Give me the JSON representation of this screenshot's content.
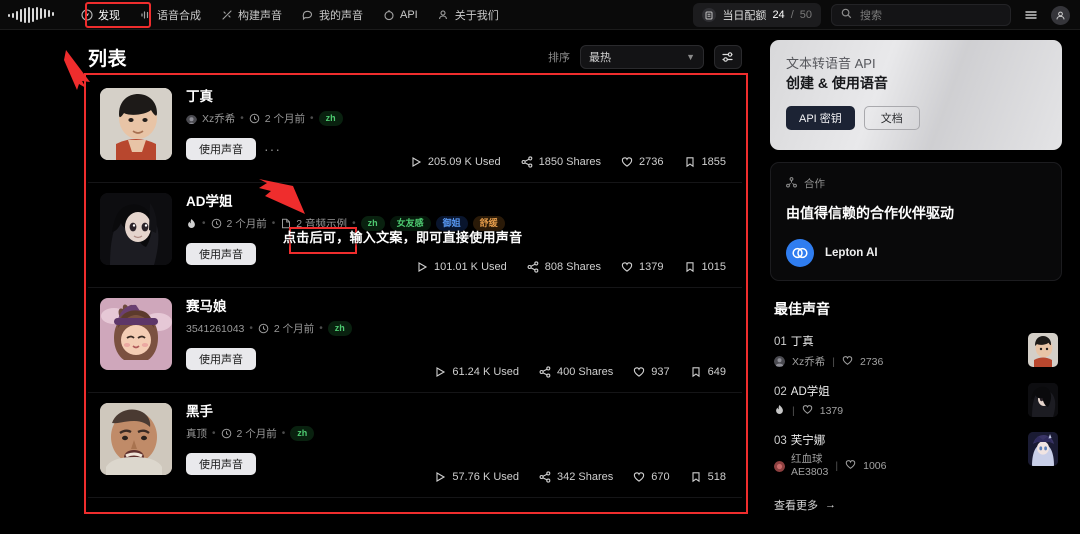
{
  "header": {
    "logo_name": "waveform-logo",
    "nav": [
      {
        "label": "发现",
        "icon": "compass-icon",
        "active": true
      },
      {
        "label": "语音合成",
        "icon": "waveform-icon",
        "active": false
      },
      {
        "label": "构建声音",
        "icon": "wand-icon",
        "active": false
      },
      {
        "label": "我的声音",
        "icon": "chat-icon",
        "active": false
      },
      {
        "label": "API",
        "icon": "api-icon",
        "active": false
      },
      {
        "label": "关于我们",
        "icon": "people-icon",
        "active": false
      }
    ],
    "quota": {
      "label": "当日配额",
      "used": "24",
      "separator": "/",
      "total": "50",
      "icon": "doc-icon"
    },
    "search": {
      "placeholder": "搜索",
      "value": "",
      "icon": "search-icon"
    },
    "menu_icon": "hamburger-icon",
    "avatar_icon": "user-avatar-icon"
  },
  "main": {
    "title": "列表",
    "sort_label": "排序",
    "sort_value": "最热",
    "filter_icon": "sliders-icon",
    "annotation": "点击后可，输入文案，即可直接使用声音",
    "use_button_label": "使用声音",
    "more_label": "···",
    "cards": [
      {
        "name": "丁真",
        "author": "Xz乔希",
        "author_icon": "avatar-icon",
        "time": "2 个月前",
        "samples": "",
        "tags": [
          {
            "text": "zh",
            "color": "zh"
          }
        ],
        "used": "205.09 K Used",
        "shares": "1850 Shares",
        "likes": "2736",
        "bookmarks": "1855",
        "show_use_button": true,
        "thumb": "portrait-ding-zhen"
      },
      {
        "name": "AD学姐",
        "author": "",
        "author_icon": "flame-icon",
        "time": "2 个月前",
        "samples": "2 音频示例",
        "tags": [
          {
            "text": "zh",
            "color": "zh"
          },
          {
            "text": "女友感",
            "color": "green"
          },
          {
            "text": "御姐",
            "color": "blue"
          },
          {
            "text": "舒缓",
            "color": "orange"
          }
        ],
        "used": "101.01 K Used",
        "shares": "808 Shares",
        "likes": "1379",
        "bookmarks": "1015",
        "show_use_button": true,
        "thumb": "anime-ad-xuejie"
      },
      {
        "name": "赛马娘",
        "author": "3541261043",
        "author_icon": "",
        "time": "2 个月前",
        "samples": "",
        "tags": [
          {
            "text": "zh",
            "color": "zh"
          }
        ],
        "used": "61.24 K Used",
        "shares": "400 Shares",
        "likes": "937",
        "bookmarks": "649",
        "show_use_button": true,
        "thumb": "anime-uma-musume"
      },
      {
        "name": "黑手",
        "author": "真顶",
        "author_icon": "",
        "time": "2 个月前",
        "samples": "",
        "tags": [
          {
            "text": "zh",
            "color": "zh"
          }
        ],
        "used": "57.76 K Used",
        "shares": "342 Shares",
        "likes": "670",
        "bookmarks": "518",
        "show_use_button": true,
        "thumb": "portrait-hei-shou"
      }
    ]
  },
  "sidebar": {
    "promo": {
      "line1": "文本转语音 API",
      "line2": "创建 & 使用语音",
      "primary_btn": "API 密钥",
      "secondary_btn": "文档"
    },
    "partner": {
      "head_label": "合作",
      "head_icon": "network-icon",
      "title": "由值得信赖的合作伙伴驱动",
      "name": "Lepton AI",
      "logo_icon": "lepton-logo-icon"
    },
    "best": {
      "title": "最佳声音",
      "items": [
        {
          "rank": "01",
          "name": "丁真",
          "author": "Xz乔希",
          "author_icon": "avatar-icon",
          "likes": "2736",
          "thumb": "portrait-ding-zhen"
        },
        {
          "rank": "02",
          "name": "AD学姐",
          "author": "",
          "author_icon": "flame-icon",
          "likes": "1379",
          "thumb": "anime-ad-xuejie"
        },
        {
          "rank": "03",
          "name": "芙宁娜",
          "author_line1": "红血球",
          "author_line2": "AE3803",
          "author_icon": "blood-cell-icon",
          "likes": "1006",
          "thumb": "anime-furina"
        }
      ],
      "more_label": "查看更多",
      "more_arrow": "→"
    }
  },
  "colors": {
    "accent_red": "#ef2d2d",
    "tag_green": "#4ecb71",
    "tag_blue": "#5a9bf7",
    "tag_orange": "#e39b4a",
    "partner_blue": "#2f7df0"
  }
}
